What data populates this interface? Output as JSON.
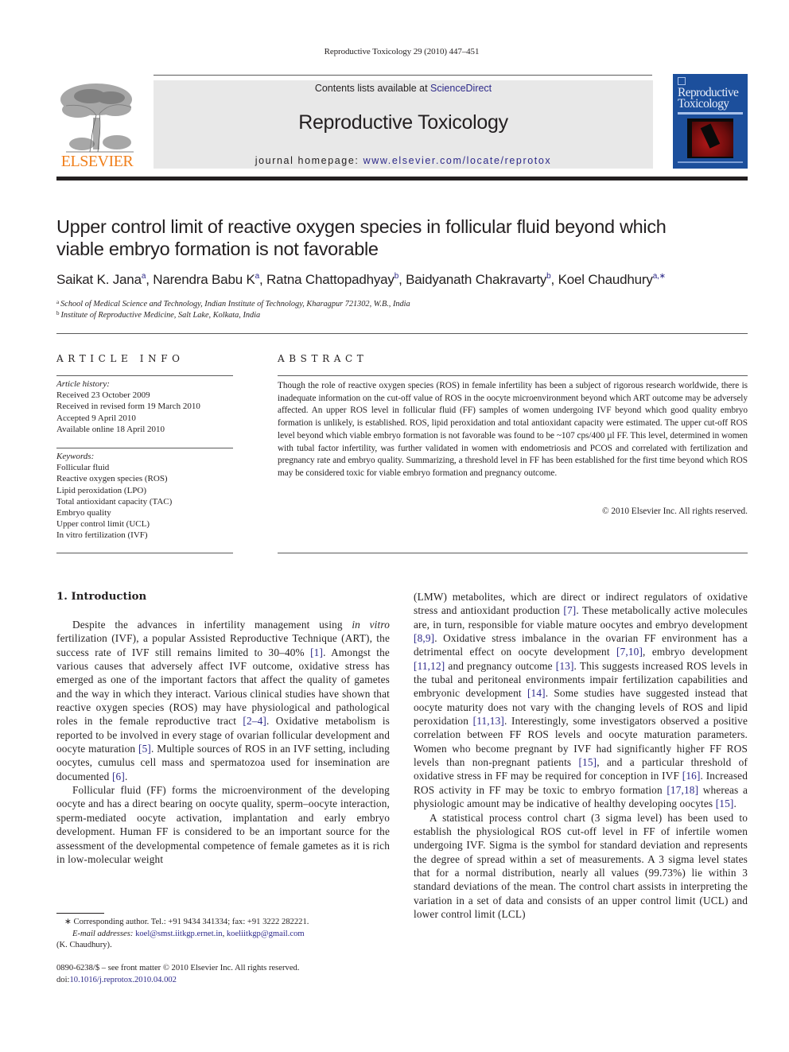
{
  "running_header": "Reproductive Toxicology 29 (2010) 447–451",
  "banner": {
    "contents_prefix": "Contents lists available at ",
    "contents_link": "ScienceDirect",
    "journal_title": "Reproductive Toxicology",
    "homepage_prefix": "journal homepage: ",
    "homepage_url": "www.elsevier.com/locate/reprotox"
  },
  "publisher_logo": {
    "name": "ELSEVIER",
    "icon": "tree-icon",
    "color": "#f07f1b"
  },
  "cover": {
    "title_line1": "Reproductive",
    "title_line2": "Toxicology",
    "color": "#1c4f9c"
  },
  "article": {
    "title_line1": "Upper control limit of reactive oxygen species in follicular fluid beyond which",
    "title_line2": "viable embryo formation is not favorable",
    "authors": [
      {
        "name": "Saikat K. Jana",
        "sup": "a"
      },
      {
        "name": "Narendra Babu K",
        "sup": "a"
      },
      {
        "name": "Ratna Chattopadhyay",
        "sup": "b"
      },
      {
        "name": "Baidyanath Chakravarty",
        "sup": "b"
      },
      {
        "name": "Koel Chaudhury",
        "sup": "a,∗"
      }
    ],
    "affiliations": [
      {
        "sup": "a",
        "text": "School of Medical Science and Technology, Indian Institute of Technology, Kharagpur 721302, W.B., India"
      },
      {
        "sup": "b",
        "text": "Institute of Reproductive Medicine, Salt Lake, Kolkata, India"
      }
    ]
  },
  "article_info": {
    "heading": "ARTICLE INFO",
    "history_label": "Article history:",
    "history": [
      "Received 23 October 2009",
      "Received in revised form 19 March 2010",
      "Accepted 9 April 2010",
      "Available online 18 April 2010"
    ],
    "keywords_label": "Keywords:",
    "keywords": [
      "Follicular fluid",
      "Reactive oxygen species (ROS)",
      "Lipid peroxidation (LPO)",
      "Total antioxidant capacity (TAC)",
      "Embryo quality",
      "Upper control limit (UCL)",
      "In vitro fertilization (IVF)"
    ]
  },
  "abstract": {
    "heading": "ABSTRACT",
    "text": "Though the role of reactive oxygen species (ROS) in female infertility has been a subject of rigorous research worldwide, there is inadequate information on the cut-off value of ROS in the oocyte microenvironment beyond which ART outcome may be adversely affected. An upper ROS level in follicular fluid (FF) samples of women undergoing IVF beyond which good quality embryo formation is unlikely, is established. ROS, lipid peroxidation and total antioxidant capacity were estimated. The upper cut-off ROS level beyond which viable embryo formation is not favorable was found to be ~107 cps/400 µl FF. This level, determined in women with tubal factor infertility, was further validated in women with endometriosis and PCOS and correlated with fertilization and pregnancy rate and embryo quality. Summarizing, a threshold level in FF has been established for the first time beyond which ROS may be considered toxic for viable embryo formation and pregnancy outcome.",
    "copyright": "© 2010 Elsevier Inc. All rights reserved."
  },
  "introduction": {
    "heading": "1.  Introduction",
    "p1": [
      {
        "t": "Despite the advances in infertility management using "
      },
      {
        "t": "in vitro",
        "i": true
      },
      {
        "t": " fertilization (IVF), a popular Assisted Reproductive Technique (ART), the success rate of IVF still remains limited to 30–40% "
      },
      {
        "t": "[1]",
        "c": true
      },
      {
        "t": ". Amongst the various causes that adversely affect IVF outcome, oxidative stress has emerged as one of the important factors that affect the quality of gametes and the way in which they interact. Various clinical studies have shown that reactive oxygen species (ROS) may have physiological and pathological roles in the female reproductive tract "
      },
      {
        "t": "[2–4]",
        "c": true
      },
      {
        "t": ". Oxidative metabolism is reported to be involved in every stage of ovarian follicular development and oocyte maturation "
      },
      {
        "t": "[5]",
        "c": true
      },
      {
        "t": ". Multiple sources of ROS in an IVF setting, including oocytes, cumulus cell mass and spermatozoa used for insemination are documented "
      },
      {
        "t": "[6]",
        "c": true
      },
      {
        "t": "."
      }
    ],
    "p2": [
      {
        "t": "Follicular fluid (FF) forms the microenvironment of the developing oocyte and has a direct bearing on oocyte quality, sperm–oocyte interaction, sperm-mediated oocyte activation, implantation and early embryo development. Human FF is considered to be an important source for the assessment of the developmental competence of female gametes as it is rich in low-molecular weight (LMW) metabolites, which are direct or indirect regulators of oxidative stress and antioxidant production "
      },
      {
        "t": "[7]",
        "c": true
      },
      {
        "t": ". These metabolically active molecules are, in turn, responsible for viable mature oocytes and embryo development "
      },
      {
        "t": "[8,9]",
        "c": true
      },
      {
        "t": ". Oxidative stress imbalance in the ovarian FF environment has a detrimental effect on oocyte development "
      },
      {
        "t": "[7,10]",
        "c": true
      },
      {
        "t": ", embryo development "
      },
      {
        "t": "[11,12]",
        "c": true
      },
      {
        "t": " and pregnancy outcome "
      },
      {
        "t": "[13]",
        "c": true
      },
      {
        "t": ". This suggests increased ROS levels in the tubal and peritoneal environments impair fertilization capabilities and embryonic development "
      },
      {
        "t": "[14]",
        "c": true
      },
      {
        "t": ". Some studies have suggested instead that oocyte maturity does not vary with the changing levels of ROS and lipid peroxidation "
      },
      {
        "t": "[11,13]",
        "c": true
      },
      {
        "t": ". Interestingly, some investigators observed a positive correlation between FF ROS levels and oocyte maturation parameters. Women who become pregnant by IVF had significantly higher FF ROS levels than non-pregnant patients "
      },
      {
        "t": "[15]",
        "c": true
      },
      {
        "t": ", and a particular threshold of oxidative stress in FF may be required for conception in IVF "
      },
      {
        "t": "[16]",
        "c": true
      },
      {
        "t": ". Increased ROS activity in FF may be toxic to embryo formation "
      },
      {
        "t": "[17,18]",
        "c": true
      },
      {
        "t": " whereas a physiologic amount may be indicative of healthy developing oocytes "
      },
      {
        "t": "[15]",
        "c": true
      },
      {
        "t": "."
      }
    ],
    "p3": "A statistical process control chart (3 sigma level) has been used to establish the physiological ROS cut-off level in FF of infertile women undergoing IVF. Sigma is the symbol for standard deviation and represents the degree of spread within a set of measurements. A 3 sigma level states that for a normal distribution, nearly all values (99.73%) lie within 3 standard deviations of the mean. The control chart assists in interpreting the variation in a set of data and consists of an upper control limit (UCL) and lower control limit (LCL)"
  },
  "footnote": {
    "marker": "∗",
    "corresponding": "Corresponding author. Tel.: +91 9434 341334; fax: +91 3222 282221.",
    "email_label": "E-mail addresses:",
    "emails": [
      "koel@smst.iitkgp.ernet.in",
      "koeliitkgp@gmail.com"
    ],
    "email_owner": "(K. Chaudhury).",
    "issn_line": "0890-6238/$ – see front matter © 2010 Elsevier Inc. All rights reserved.",
    "doi_prefix": "doi:",
    "doi": "10.1016/j.reprotox.2010.04.002"
  }
}
